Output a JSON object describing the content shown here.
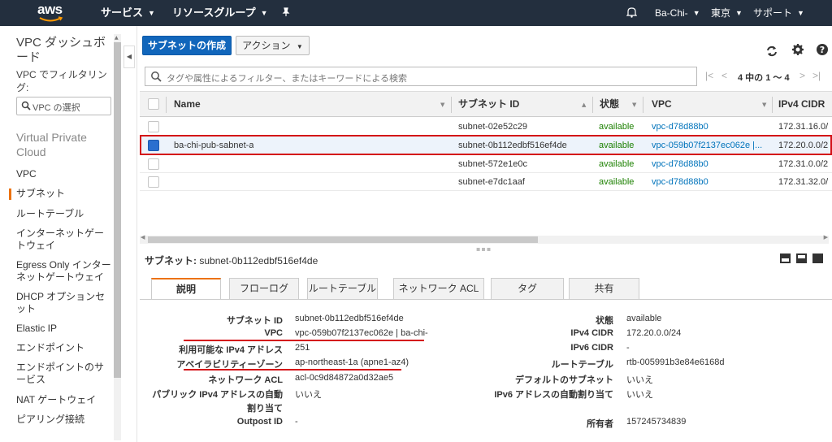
{
  "topnav": {
    "logo": "aws",
    "services": "サービス",
    "resource_groups": "リソースグループ",
    "pin_icon": "pin-icon",
    "bell_icon": "bell-icon",
    "account": "Ba-Chi-",
    "region": "東京",
    "support": "サポート"
  },
  "sidebar": {
    "title": "VPC ダッシュボード",
    "filter_label": "VPC でフィルタリング:",
    "select_placeholder": "VPC の選択",
    "section": "Virtual Private Cloud",
    "items": [
      {
        "label": "VPC"
      },
      {
        "label": "サブネット"
      },
      {
        "label": "ルートテーブル"
      },
      {
        "label": "インターネットゲートウェイ"
      },
      {
        "label": "Egress Only インターネットゲートウェイ"
      },
      {
        "label": "DHCP オプションセット"
      },
      {
        "label": "Elastic IP"
      },
      {
        "label": "エンドポイント"
      },
      {
        "label": "エンドポイントのサービス"
      },
      {
        "label": "NAT ゲートウェイ"
      },
      {
        "label": "ピアリング接続"
      }
    ]
  },
  "toolbar": {
    "create_button": "サブネットの作成",
    "action_button": "アクション"
  },
  "search": {
    "placeholder": "タグや属性によるフィルター、またはキーワードによる検索"
  },
  "pager": {
    "text": "4 中の 1 ～ 4"
  },
  "table": {
    "headers": {
      "name": "Name",
      "subnet_id": "サブネット ID",
      "state": "状態",
      "vpc": "VPC",
      "ipv4": "IPv4 CIDR"
    },
    "rows": [
      {
        "name": "",
        "subnet_id": "subnet-02e52c29",
        "state": "available",
        "vpc": "vpc-d78d88b0",
        "ipv4": "172.31.16.0/"
      },
      {
        "name": "ba-chi-pub-sabnet-a",
        "subnet_id": "subnet-0b112edbf516ef4de",
        "state": "available",
        "vpc": "vpc-059b07f2137ec062e |...",
        "ipv4": "172.20.0.0/2"
      },
      {
        "name": "",
        "subnet_id": "subnet-572e1e0c",
        "state": "available",
        "vpc": "vpc-d78d88b0",
        "ipv4": "172.31.0.0/2"
      },
      {
        "name": "",
        "subnet_id": "subnet-e7dc1aaf",
        "state": "available",
        "vpc": "vpc-d78d88b0",
        "ipv4": "172.31.32.0/"
      }
    ]
  },
  "detail": {
    "header_label": "サブネット:",
    "header_value": "subnet-0b112edbf516ef4de",
    "tabs": [
      "説明",
      "フローログ",
      "ルートテーブル",
      "ネットワーク ACL",
      "タグ",
      "共有"
    ],
    "left": [
      {
        "key": "サブネット ID",
        "value": "subnet-0b112edbf516ef4de"
      },
      {
        "key": "VPC",
        "value": "vpc-059b07f2137ec062e | ba-chi-"
      },
      {
        "key": "利用可能な IPv4 アドレス",
        "value": "251"
      },
      {
        "key": "アベイラビリティーゾーン",
        "value": "ap-northeast-1a (apne1-az4)"
      },
      {
        "key": "ネットワーク ACL",
        "value": "acl-0c9d84872a0d32ae5"
      },
      {
        "key": "パブリック IPv4 アドレスの自動",
        "key2": "割り当て",
        "value": "いいえ"
      },
      {
        "key": "Outpost ID",
        "value": "-"
      }
    ],
    "right": [
      {
        "key": "状態",
        "value": "available"
      },
      {
        "key": "IPv4 CIDR",
        "value": "172.20.0.0/24"
      },
      {
        "key": "IPv6 CIDR",
        "value": "-"
      },
      {
        "key": "ルートテーブル",
        "value": "rtb-005991b3e84e6168d"
      },
      {
        "key": "デフォルトのサブネット",
        "value": "いいえ"
      },
      {
        "key": "IPv6 アドレスの自動割り当て",
        "value": "いいえ"
      },
      {
        "key": "所有者",
        "value": "157245734839"
      }
    ]
  },
  "colors": {
    "nav_bg": "#232f3e",
    "primary": "#1166bb",
    "accent": "#ec7211",
    "available": "#1d8102",
    "link": "#0073bb",
    "highlight": "#d40f16"
  }
}
